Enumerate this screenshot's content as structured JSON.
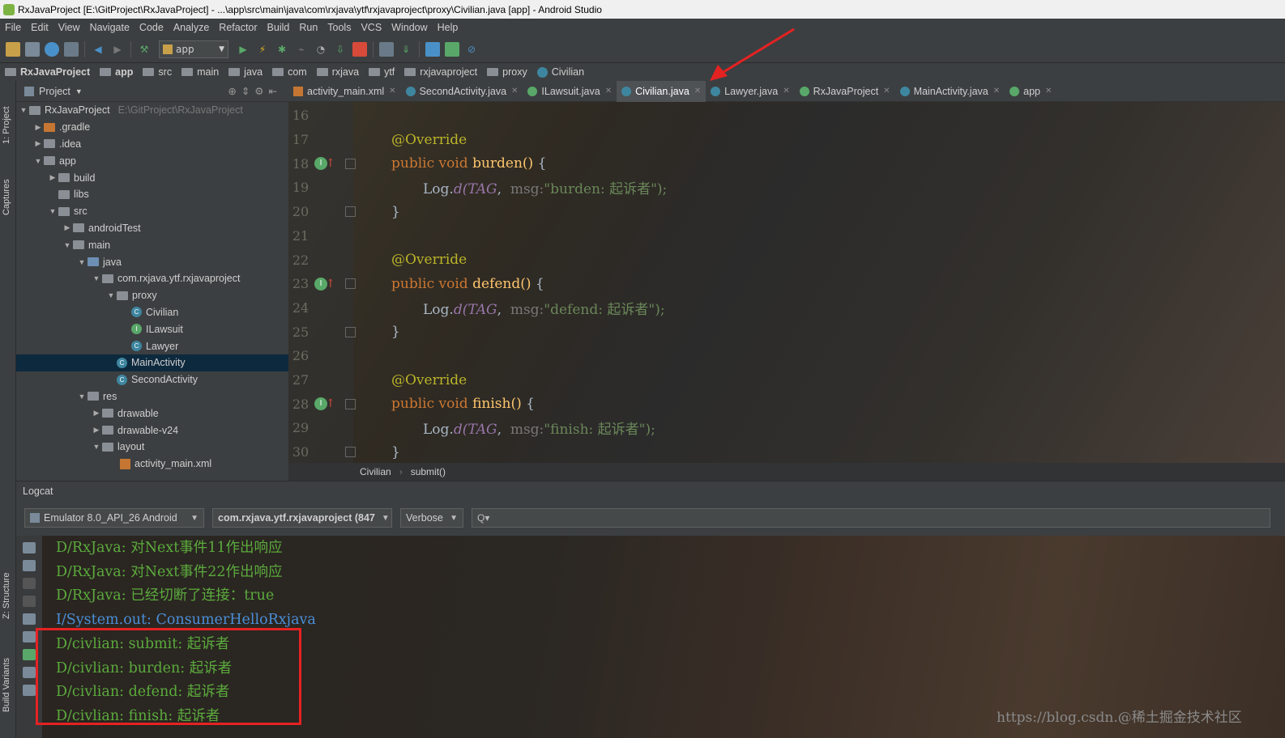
{
  "window": {
    "title": "RxJavaProject [E:\\GitProject\\RxJavaProject] - ...\\app\\src\\main\\java\\com\\rxjava\\ytf\\rxjavaproject\\proxy\\Civilian.java [app] - Android Studio"
  },
  "menu": [
    "File",
    "Edit",
    "View",
    "Navigate",
    "Code",
    "Analyze",
    "Refactor",
    "Build",
    "Run",
    "Tools",
    "VCS",
    "Window",
    "Help"
  ],
  "toolbar": {
    "run_config": "app"
  },
  "breadcrumb": [
    "RxJavaProject",
    "app",
    "src",
    "main",
    "java",
    "com",
    "rxjava",
    "ytf",
    "rxjavaproject",
    "proxy",
    "Civilian"
  ],
  "left_strip": {
    "project": "1: Project",
    "captures": "Captures",
    "structure": "Z: Structure",
    "build_variants": "Build Variants"
  },
  "project_panel": {
    "header": "Project",
    "tree": [
      {
        "label": "RxJavaProject",
        "path": "E:\\GitProject\\RxJavaProject"
      },
      {
        "label": ".gradle"
      },
      {
        "label": ".idea"
      },
      {
        "label": "app"
      },
      {
        "label": "build"
      },
      {
        "label": "libs"
      },
      {
        "label": "src"
      },
      {
        "label": "androidTest"
      },
      {
        "label": "main"
      },
      {
        "label": "java"
      },
      {
        "label": "com.rxjava.ytf.rxjavaproject"
      },
      {
        "label": "proxy"
      },
      {
        "label": "Civilian"
      },
      {
        "label": "ILawsuit"
      },
      {
        "label": "Lawyer"
      },
      {
        "label": "MainActivity"
      },
      {
        "label": "SecondActivity"
      },
      {
        "label": "res"
      },
      {
        "label": "drawable"
      },
      {
        "label": "drawable-v24"
      },
      {
        "label": "layout"
      },
      {
        "label": "activity_main.xml"
      }
    ]
  },
  "editor_tabs": [
    {
      "label": "activity_main.xml",
      "active": false
    },
    {
      "label": "SecondActivity.java",
      "active": false
    },
    {
      "label": "ILawsuit.java",
      "active": false
    },
    {
      "label": "Civilian.java",
      "active": true
    },
    {
      "label": "Lawyer.java",
      "active": false
    },
    {
      "label": "RxJavaProject",
      "active": false
    },
    {
      "label": "MainActivity.java",
      "active": false
    },
    {
      "label": "app",
      "active": false
    }
  ],
  "code": {
    "line_numbers": [
      "16",
      "17",
      "18",
      "19",
      "20",
      "21",
      "22",
      "23",
      "24",
      "25",
      "26",
      "27",
      "28",
      "29",
      "30"
    ],
    "annotation": "@Override",
    "public_void": "public void",
    "methods": [
      "burden()",
      "defend()",
      "finish()"
    ],
    "brace_open": "{",
    "brace_close": "}",
    "log_prefix": "Log.",
    "log_method": "d(",
    "tag": "TAG",
    "msg_hint": "msg:",
    "strings": [
      "\"burden: 起诉者\");",
      "\"defend: 起诉者\");",
      "\"finish: 起诉者\");"
    ]
  },
  "editor_breadcrumb": {
    "class": "Civilian",
    "method": "submit()"
  },
  "logcat": {
    "title": "Logcat",
    "device": "Emulator 8.0_API_26 Android",
    "process": "com.rxjava.ytf.rxjavaproject (847",
    "level": "Verbose",
    "search_placeholder": "Q▾",
    "lines": [
      "D/RxJava: 对Next事件11作出响应",
      "D/RxJava: 对Next事件22作出响应",
      "D/RxJava: 已经切断了连接：true",
      "I/System.out: ConsumerHelloRxjava",
      "D/civlian: submit: 起诉者",
      "D/civlian: burden: 起诉者",
      "D/civlian: defend: 起诉者",
      "D/civlian: finish: 起诉者"
    ]
  },
  "watermark": "https://blog.csdn.@稀土掘金技术社区",
  "colors": {
    "log_debug": "#5bab3d",
    "log_info": "#4a8fd8",
    "highlight": "#e52222"
  }
}
